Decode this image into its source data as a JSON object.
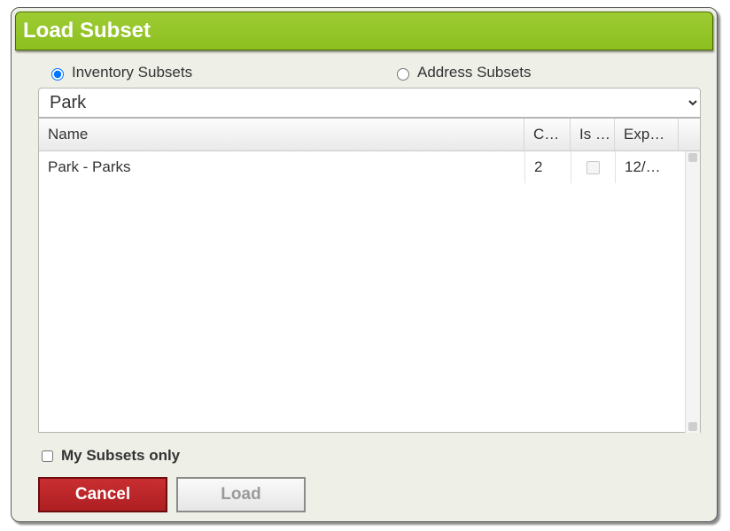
{
  "title": "Load Subset",
  "subsetTypes": {
    "inventory": {
      "label": "Inventory Subsets",
      "checked": true
    },
    "address": {
      "label": "Address Subsets",
      "checked": false
    }
  },
  "select": {
    "selected": "Park",
    "options": [
      "Park"
    ]
  },
  "grid": {
    "headers": {
      "name": "Name",
      "c": "C…",
      "is": "Is …",
      "exp": "Exp…"
    },
    "rows": [
      {
        "name": "Park - Parks",
        "c": "2",
        "is": false,
        "exp": "12/…"
      }
    ]
  },
  "mySubsets": {
    "label": "My Subsets only",
    "checked": false
  },
  "buttons": {
    "cancel": "Cancel",
    "load": "Load"
  }
}
